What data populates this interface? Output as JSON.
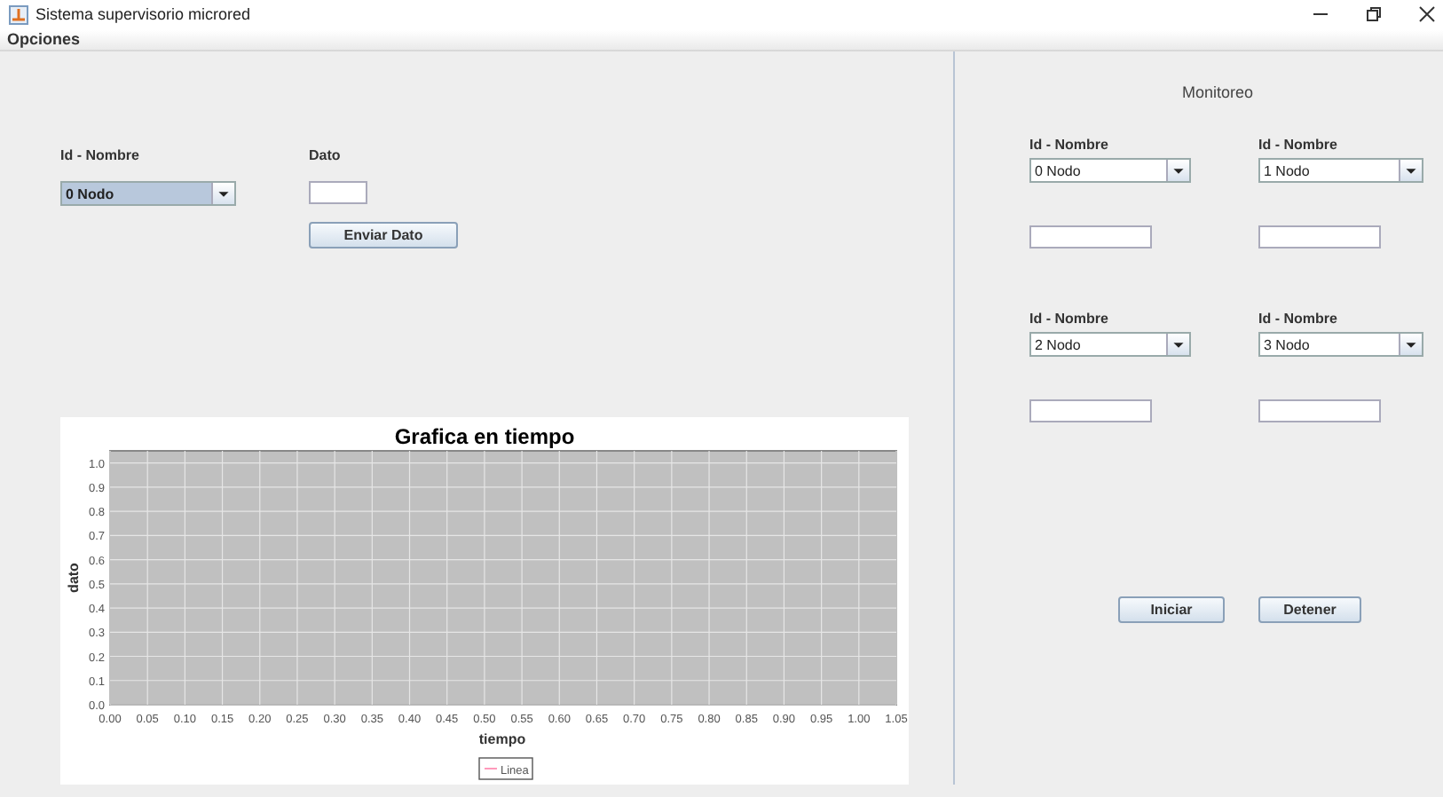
{
  "window": {
    "title": "Sistema supervisorio microred"
  },
  "menu": [
    "Opciones"
  ],
  "send_panel": {
    "id_label": "Id - Nombre",
    "combo": {
      "value": "0 Nodo",
      "selected": true
    },
    "data_label": "Dato",
    "button": "Enviar Dato"
  },
  "chart": {
    "chart_data": {
      "type": "line",
      "grid": true,
      "title": "Grafica en tiempo",
      "xlabel": "tiempo",
      "ylabel": "dato",
      "ylim": [
        0,
        1.05
      ],
      "categories": [
        "0.00",
        "0.05",
        "0.10",
        "0.15",
        "0.20",
        "0.25",
        "0.30",
        "0.35",
        "0.40",
        "0.45",
        "0.50",
        "0.55",
        "0.60",
        "0.65",
        "0.70",
        "0.75",
        "0.80",
        "0.85",
        "0.90",
        "0.95",
        "1.00",
        "1.05"
      ],
      "yticks": [
        {
          "value": 0,
          "label": "0.0"
        },
        {
          "value": 0.1,
          "label": "0.1"
        },
        {
          "value": 0.2,
          "label": "0.2"
        },
        {
          "value": 0.3,
          "label": "0.3"
        },
        {
          "value": 0.4,
          "label": "0.4"
        },
        {
          "value": 0.5,
          "label": "0.5"
        },
        {
          "value": 0.6,
          "label": "0.6"
        },
        {
          "value": 0.7,
          "label": "0.7"
        },
        {
          "value": 0.8,
          "label": "0.8"
        },
        {
          "value": 0.9,
          "label": "0.9"
        },
        {
          "value": 1,
          "label": "1.0"
        }
      ],
      "series": [
        {
          "name": "Linea",
          "color": "#ff99bb",
          "values": [
            null,
            null,
            null,
            null,
            null,
            null,
            null,
            null,
            null,
            null,
            null,
            null,
            null,
            null,
            null,
            null,
            null,
            null,
            null,
            null,
            null,
            null
          ]
        }
      ]
    }
  },
  "monitor": {
    "title": "Monitoreo",
    "nodes": [
      {
        "label": "Id - Nombre",
        "combo": "0 Nodo"
      },
      {
        "label": "Id - Nombre",
        "combo": "1 Nodo"
      },
      {
        "label": "Id - Nombre",
        "combo": "2 Nodo"
      },
      {
        "label": "Id - Nombre",
        "combo": "3 Nodo"
      }
    ],
    "buttons": [
      "Iniciar",
      "Detener"
    ]
  }
}
